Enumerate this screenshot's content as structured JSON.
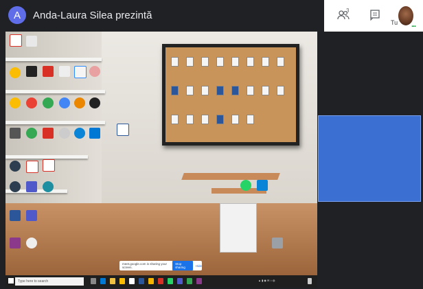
{
  "meeting": {
    "presenter_initial": "A",
    "presenting_title": "Anda-Laura Silea prezintă",
    "people_count": "3",
    "self_label": "Tu",
    "self_tile_color": "#3b6fd1"
  },
  "shared_screen": {
    "share_notice": "meet.google.com is sharing your screen.",
    "stop_sharing_label": "Stop sharing",
    "hide_label": "Hide",
    "search_placeholder": "Type here to search",
    "desktop_icons": [
      {
        "label": "Acrobat",
        "color": "#d93025"
      },
      {
        "label": "Google Chrome",
        "color": "#fbbc04"
      },
      {
        "label": "Adobe Acrobat",
        "color": "#d93025"
      },
      {
        "label": "Zoom",
        "color": "#2d8cff"
      },
      {
        "label": "Word",
        "color": "#2b579a"
      },
      {
        "label": "WhatsApp",
        "color": "#25d366"
      },
      {
        "label": "Edge",
        "color": "#0a84d6"
      },
      {
        "label": "Teams",
        "color": "#5059c9"
      },
      {
        "label": "WinRAR",
        "color": "#8b3a8b"
      },
      {
        "label": "Recycle Bin",
        "color": "#9aa0a6"
      }
    ]
  }
}
